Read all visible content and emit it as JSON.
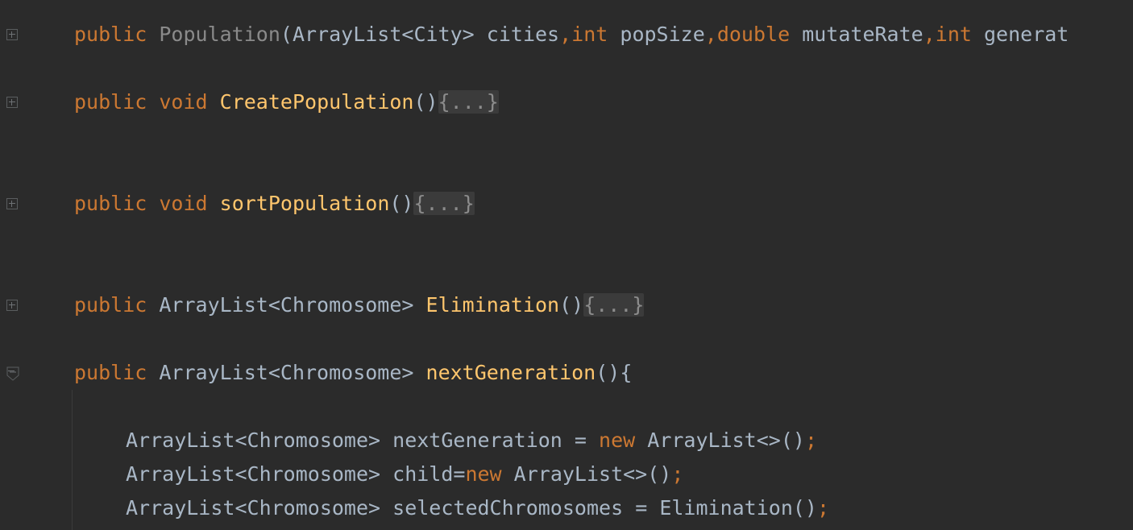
{
  "code": {
    "line1": {
      "kw1": "public",
      "ctor": "Population",
      "open": "(",
      "type1": "ArrayList<City>",
      "p1": "cities",
      "c1": ",",
      "kw2": "int",
      "p2": "popSize",
      "c2": ",",
      "kw3": "double",
      "p3": "mutateRate",
      "c3": ",",
      "kw4": "int",
      "p4": "generat"
    },
    "line2": {
      "kw1": "public",
      "kw2": "void",
      "fn": "CreatePopulation",
      "parens": "()",
      "folded": "{...}"
    },
    "line3": {
      "kw1": "public",
      "kw2": "void",
      "fn": "sortPopulation",
      "parens": "()",
      "folded": "{...}"
    },
    "line4": {
      "kw1": "public",
      "type": "ArrayList<Chromosome>",
      "fn": "Elimination",
      "parens": "()",
      "folded": "{...}"
    },
    "line5": {
      "kw1": "public",
      "type": "ArrayList<Chromosome>",
      "fn": "nextGeneration",
      "parens": "(){"
    },
    "line6": {
      "type": "ArrayList<Chromosome>",
      "var": "nextGeneration",
      "eq": "=",
      "kw": "new",
      "rhs": "ArrayList<>()",
      "semi": ";"
    },
    "line7": {
      "type": "ArrayList<Chromosome>",
      "var": "child=",
      "kw": "new",
      "rhs": "ArrayList<>()",
      "semi": ";"
    },
    "line8": {
      "type": "ArrayList<Chromosome>",
      "var": "selectedChromosomes",
      "eq": "=",
      "rhs": "Elimination()",
      "semi": ";"
    }
  },
  "colors": {
    "background": "#2b2b2b",
    "keyword": "#cc7832",
    "function": "#ffc66d",
    "text": "#a9b7c6",
    "folded_bg": "#3b3b3b"
  }
}
